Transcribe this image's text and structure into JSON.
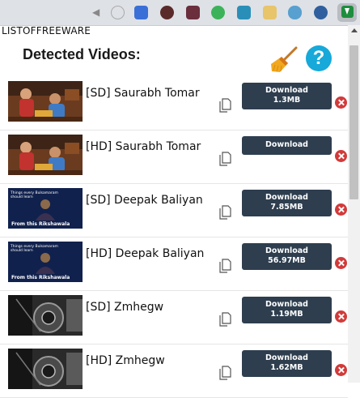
{
  "browser": {
    "extension_icons": [
      "back-icon",
      "circle-icon",
      "bookmark-icon",
      "red-dot-icon",
      "camera-icon",
      "green-icon",
      "puzzle-icon",
      "pencil-icon",
      "cloud-icon",
      "video-downloader-icon"
    ]
  },
  "watermark": "LISTOFFREEWARE",
  "popup": {
    "heading": "Detected Videos:",
    "clear_icon": "broom-icon",
    "help_label": "?"
  },
  "videos": [
    {
      "title": "[SD] Saurabh Tomar",
      "button_label": "Download",
      "size": "1.3MB",
      "thumb": "colorful-indoor-scene"
    },
    {
      "title": "[HD] Saurabh Tomar",
      "button_label": "Download",
      "size": "",
      "thumb": "colorful-indoor-scene"
    },
    {
      "title": "[SD] Deepak Baliyan",
      "button_label": "Download",
      "size": "7.85MB",
      "thumb": "speaker-dark-blue-scene",
      "thumb_text_top": "Things every Bulsamaram\nshould learn",
      "thumb_text_bottom": "From this Rikshawala"
    },
    {
      "title": "[HD] Deepak Baliyan",
      "button_label": "Download",
      "size": "56.97MB",
      "thumb": "speaker-dark-blue-scene",
      "thumb_text_top": "Things every Bulsamaram\nshould learn",
      "thumb_text_bottom": "From this Rikshawala"
    },
    {
      "title": "[SD] Zmhegw",
      "button_label": "Download",
      "size": "1.19MB",
      "thumb": "mechanical-bw-scene"
    },
    {
      "title": "[HD] Zmhegw",
      "button_label": "Download",
      "size": "1.62MB",
      "thumb": "mechanical-bw-scene"
    }
  ],
  "colors": {
    "button_bg": "#2e3e4f",
    "help_bg": "#16a9d9",
    "close_bg": "#d23a3a"
  }
}
